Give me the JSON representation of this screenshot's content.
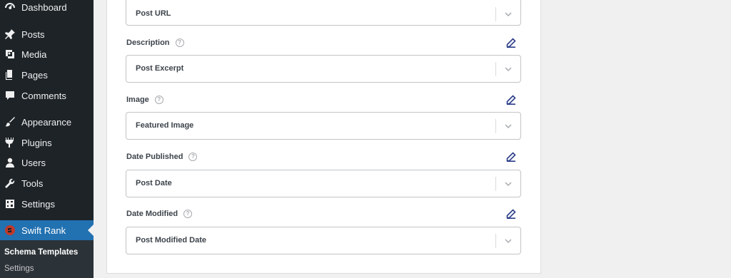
{
  "sidebar": {
    "items": [
      {
        "label": "Dashboard",
        "icon": "dashboard-icon"
      },
      {
        "label": "Posts",
        "icon": "pin-icon"
      },
      {
        "label": "Media",
        "icon": "media-icon"
      },
      {
        "label": "Pages",
        "icon": "pages-icon"
      },
      {
        "label": "Comments",
        "icon": "comment-icon"
      },
      {
        "label": "Appearance",
        "icon": "brush-icon"
      },
      {
        "label": "Plugins",
        "icon": "plugin-icon"
      },
      {
        "label": "Users",
        "icon": "user-icon"
      },
      {
        "label": "Tools",
        "icon": "wrench-icon"
      },
      {
        "label": "Settings",
        "icon": "settings-icon"
      },
      {
        "label": "Swift Rank",
        "icon": "swift-rank-logo-icon"
      }
    ],
    "submenu": {
      "current": "Schema Templates",
      "next": "Settings"
    }
  },
  "fields": {
    "url": {
      "value": "Post URL"
    },
    "description": {
      "label": "Description",
      "value": "Post Excerpt"
    },
    "image": {
      "label": "Image",
      "value": "Featured Image"
    },
    "date_published": {
      "label": "Date Published",
      "value": "Post Date"
    },
    "date_modified": {
      "label": "Date Modified",
      "value": "Post Modified Date"
    }
  },
  "colors": {
    "sidebar_bg": "#1d2327",
    "active_bg": "#2271b1",
    "edit_icon": "#2c3e8a"
  }
}
